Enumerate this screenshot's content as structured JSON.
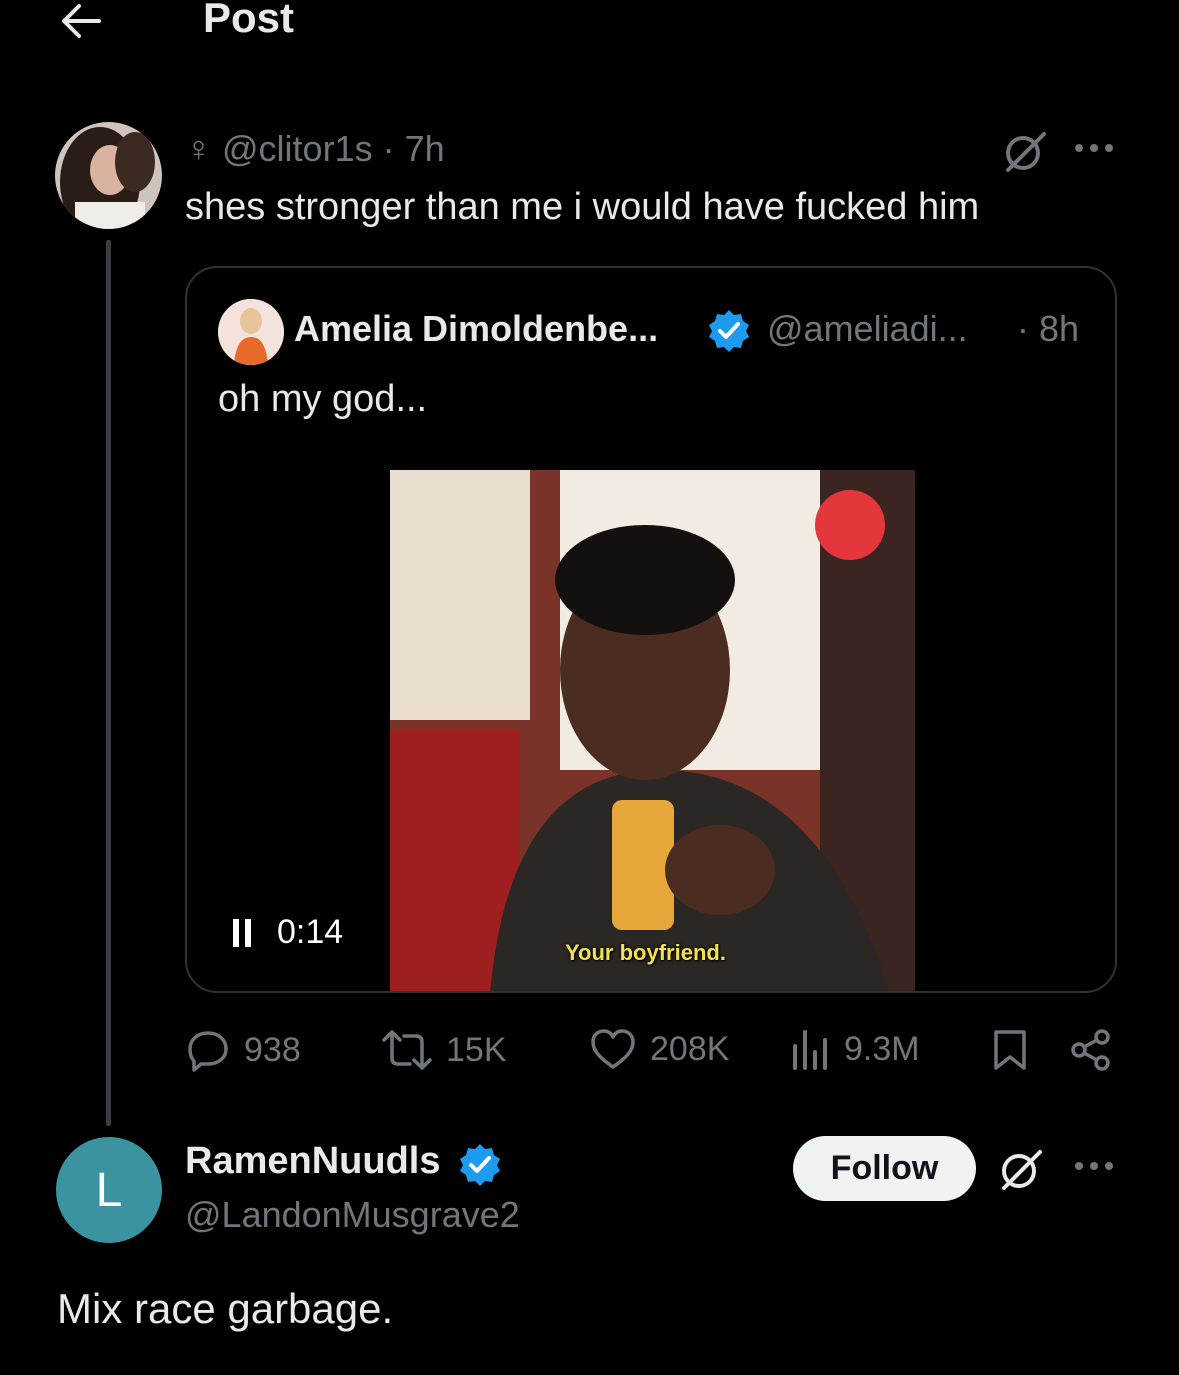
{
  "header": {
    "title": "Post"
  },
  "tweet": {
    "handle_line": "♀ @clitor1s · 7h",
    "text": "shes stronger than me i would have fucked him"
  },
  "quote": {
    "name": "Amelia Dimoldenbe...",
    "handle": "@ameliadi...",
    "time": "· 8h",
    "text": "oh my god...",
    "video": {
      "time": "0:14",
      "caption": "Your boyfriend."
    }
  },
  "actions": {
    "replies": "938",
    "reposts": "15K",
    "likes": "208K",
    "views": "9.3M"
  },
  "reply": {
    "avatar_letter": "L",
    "name": "RamenNuudls",
    "handle": "@LandonMusgrave2",
    "follow_label": "Follow",
    "text": "Mix race garbage."
  },
  "colors": {
    "background": "#000000",
    "text_primary": "#e7e9ea",
    "text_secondary": "#71767b",
    "verified": "#1d9bf0",
    "avatar_l": "#3b939f",
    "follow_bg": "#eff3f4"
  },
  "icons": [
    "back-arrow-icon",
    "grok-icon",
    "more-icon",
    "verified-icon",
    "pause-icon",
    "reply-icon",
    "repost-icon",
    "like-icon",
    "views-icon",
    "bookmark-icon",
    "share-icon"
  ]
}
